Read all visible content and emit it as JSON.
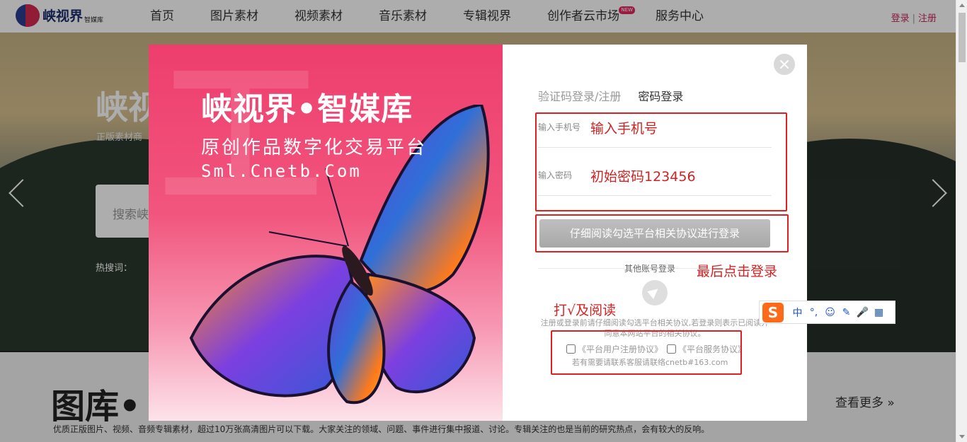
{
  "nav": {
    "logo_text": "峡视界",
    "logo_sub": "智媒库",
    "menu": [
      {
        "label": "首页"
      },
      {
        "label": "图片素材"
      },
      {
        "label": "视频素材"
      },
      {
        "label": "音乐素材"
      },
      {
        "label": "专辑视界"
      },
      {
        "label": "创作者云市场",
        "badge": "NEW"
      },
      {
        "label": "服务中心"
      }
    ],
    "login": "登录",
    "register": "注册"
  },
  "hero": {
    "title": "峡视",
    "subtitle": "正版素材商",
    "search_placeholder": "搜索峡",
    "hot_label": "热搜词："
  },
  "section": {
    "title": "图库•",
    "more": "查看更多 »",
    "desc": "优质正版图片、视频、音频专辑素材，超过10万张高清图片可以下载。大家关注的领域、问题、事件进行集中报道、讨论。专辑关注的也是当前的研究热点，会有较大的反响。"
  },
  "modal": {
    "promo": {
      "title": "峡视界•智媒库",
      "subtitle": "原创作品数字化交易平台",
      "url": "Sml.Cnetb.Com"
    },
    "tabs": [
      {
        "label": "验证码登录/注册",
        "active": false
      },
      {
        "label": "密码登录",
        "active": true
      }
    ],
    "phone_label": "输入手机号",
    "phone_value": "输入手机号",
    "password_label": "输入密码",
    "password_value": "初始密码123456",
    "login_button": "仔细阅读勾选平台相关协议进行登录",
    "other_login": "其他账号登录",
    "annotation_login": "最后点击登录",
    "annotation_agree": "打√及阅读",
    "notice": "注册或登录前请仔细阅读勾选平台相关协议,若登录则表示已阅读并同意本网站平台的相关协议。",
    "agreements": [
      "《平台用户注册协议》",
      "《平台服务协议》"
    ],
    "contact": "若有需要请联系客服请联络cnetb#163.com"
  },
  "ime": {
    "logo": "S",
    "items": [
      "中",
      "°,",
      "☺",
      "✎",
      "🎤",
      "▦"
    ]
  },
  "colors": {
    "accent": "#c8265e",
    "annotation_red": "#d62222",
    "promo_pink": "#ee3e6d"
  }
}
